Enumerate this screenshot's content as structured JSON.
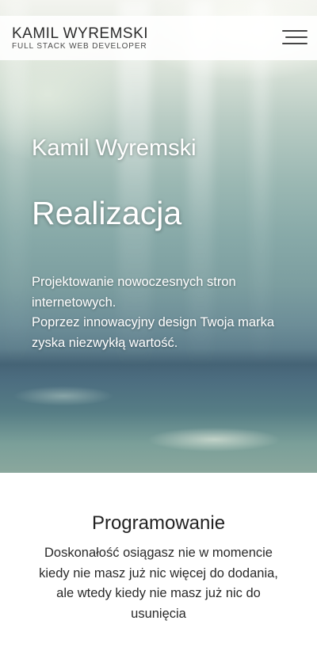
{
  "header": {
    "brand_name": "KAMIL WYREMSKI",
    "brand_tagline": "FULL STACK WEB DEVELOPER",
    "menu_icon": "hamburger-menu-icon"
  },
  "hero": {
    "subtitle": "Kamil Wyremski",
    "title": "Realizacja",
    "description_lines": [
      "Projektowanie nowoczesnych stron",
      "internetowych.",
      "Poprzez innowacyjny design Twoja marka",
      "zyska niezwykłą wartość."
    ]
  },
  "section": {
    "title": "Programowanie",
    "text_lines": [
      "Doskonałość osiągasz nie w momencie",
      "kiedy nie masz już nic więcej do dodania,",
      "ale wtedy kiedy nie masz już nic do",
      "usunięcia"
    ]
  },
  "colors": {
    "hero_text": "#ffffff",
    "header_background": "#ffffff",
    "body_text": "#222222"
  }
}
